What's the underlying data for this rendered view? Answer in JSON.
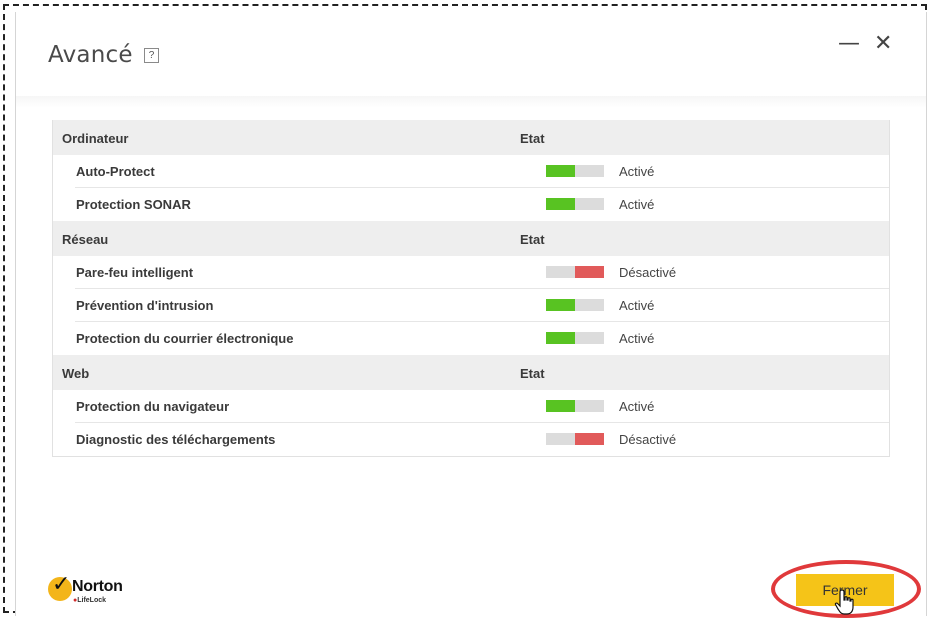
{
  "window": {
    "title": "Avancé",
    "help_label": "?",
    "minimize_label": "—",
    "close_label": "✕"
  },
  "columns": {
    "state_header": "Etat"
  },
  "sections": [
    {
      "name": "Ordinateur",
      "state": "Etat",
      "rows": [
        {
          "label": "Auto-Protect",
          "status": "Activé",
          "enabled": true
        },
        {
          "label": "Protection SONAR",
          "status": "Activé",
          "enabled": true
        }
      ]
    },
    {
      "name": "Réseau",
      "state": "Etat",
      "rows": [
        {
          "label": "Pare-feu intelligent",
          "status": "Désactivé",
          "enabled": false
        },
        {
          "label": "Prévention d'intrusion",
          "status": "Activé",
          "enabled": true
        },
        {
          "label": "Protection du courrier électronique",
          "status": "Activé",
          "enabled": true
        }
      ]
    },
    {
      "name": "Web",
      "state": "Etat",
      "rows": [
        {
          "label": "Protection du navigateur",
          "status": "Activé",
          "enabled": true
        },
        {
          "label": "Diagnostic des téléchargements",
          "status": "Désactivé",
          "enabled": false
        }
      ]
    }
  ],
  "brand": {
    "name": "Norton",
    "sub": "LifeLock"
  },
  "footer": {
    "close_button": "Fermer"
  },
  "colors": {
    "on": "#58c322",
    "off": "#e15a5a",
    "toggle_bg": "#dcdcdc",
    "button": "#f5c418",
    "highlight": "#e0393b"
  }
}
